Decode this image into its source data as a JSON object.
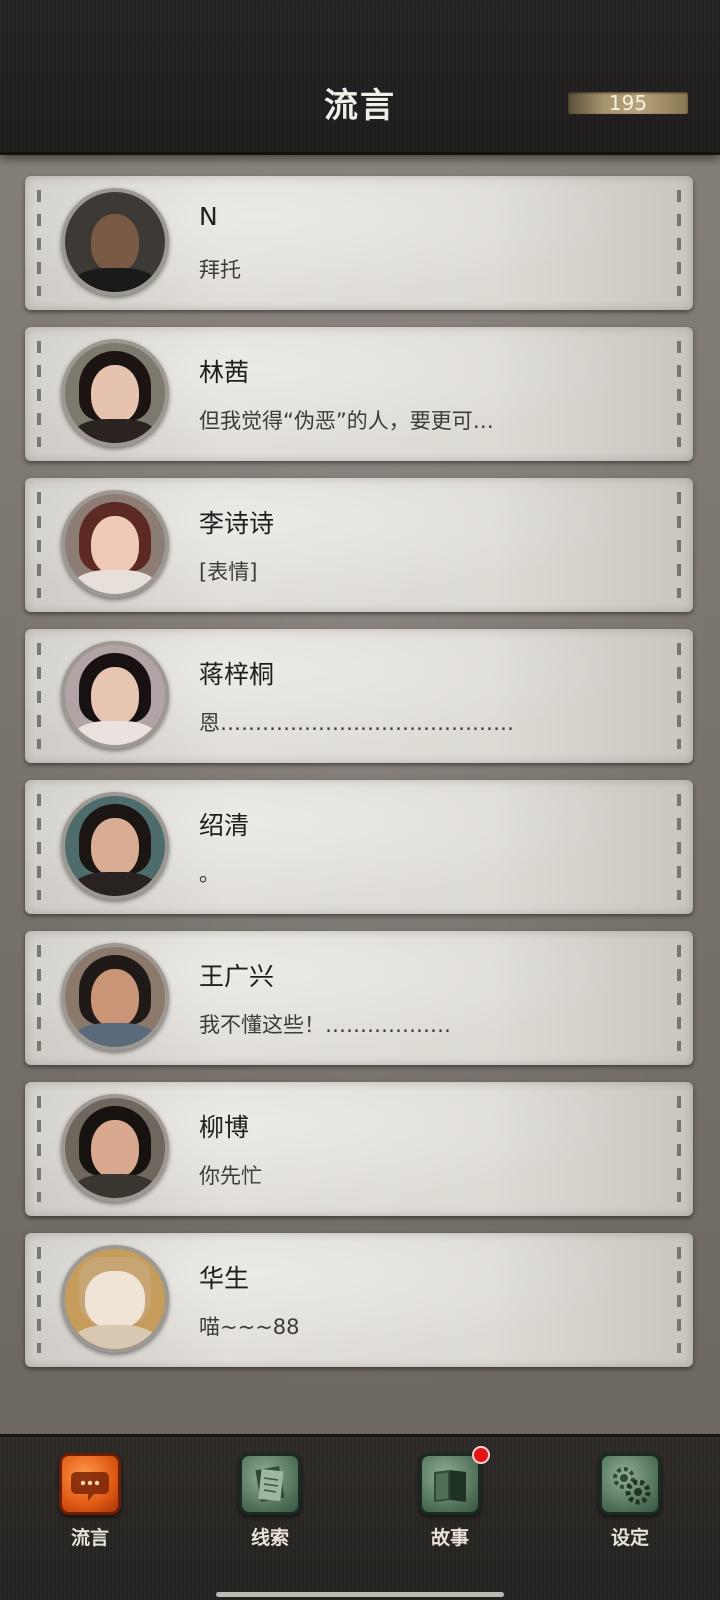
{
  "header": {
    "title": "流言",
    "counter": "195"
  },
  "conversations": [
    {
      "name": "N",
      "message": "拜托",
      "avatar": {
        "skin": "#7a5a44",
        "hair": "#1c1814",
        "clothes": "#1a1a1a",
        "bg": "#3d3a36"
      }
    },
    {
      "name": "林茜",
      "message": "但我觉得“伪恶”的人，要更可…",
      "avatar": {
        "skin": "#e6c3ae",
        "hair": "#1c1412",
        "clothes": "#2a2320",
        "bg": "#7b7a6c"
      }
    },
    {
      "name": "李诗诗",
      "message": "[表情]",
      "avatar": {
        "skin": "#efcbb7",
        "hair": "#5c2a22",
        "clothes": "#e7e0da",
        "bg": "#8e7d74"
      }
    },
    {
      "name": "蒋梓桐",
      "message": "恩……………………………………",
      "avatar": {
        "skin": "#e8c4b2",
        "hair": "#171211",
        "clothes": "#e9e2de",
        "bg": "#b1a3a6"
      }
    },
    {
      "name": "绍清",
      "message": "。",
      "avatar": {
        "skin": "#d9ad94",
        "hair": "#1b1514",
        "clothes": "#2a2220",
        "bg": "#4f6c6c"
      }
    },
    {
      "name": "王广兴",
      "message": "我不懂这些！………………",
      "avatar": {
        "skin": "#c99576",
        "hair": "#1f1a17",
        "clothes": "#5a6a7a",
        "bg": "#8b7a6b"
      }
    },
    {
      "name": "柳博",
      "message": "你先忙",
      "avatar": {
        "skin": "#d8a98e",
        "hair": "#151210",
        "clothes": "#3b3530",
        "bg": "#6f675d"
      }
    },
    {
      "name": "华生",
      "message": "喵~~~88",
      "avatar": {
        "skin": "#efe4d6",
        "hair": "#c8a574",
        "clothes": "#d9c8b2",
        "bg": "#c59c5a"
      }
    }
  ],
  "tabs": [
    {
      "label": "流言",
      "icon": "chat-bubble-icon",
      "active": true
    },
    {
      "label": "线索",
      "icon": "documents-icon",
      "active": false
    },
    {
      "label": "故事",
      "icon": "book-icon",
      "active": false,
      "badge": true
    },
    {
      "label": "设定",
      "icon": "gear-icon",
      "active": false
    }
  ]
}
